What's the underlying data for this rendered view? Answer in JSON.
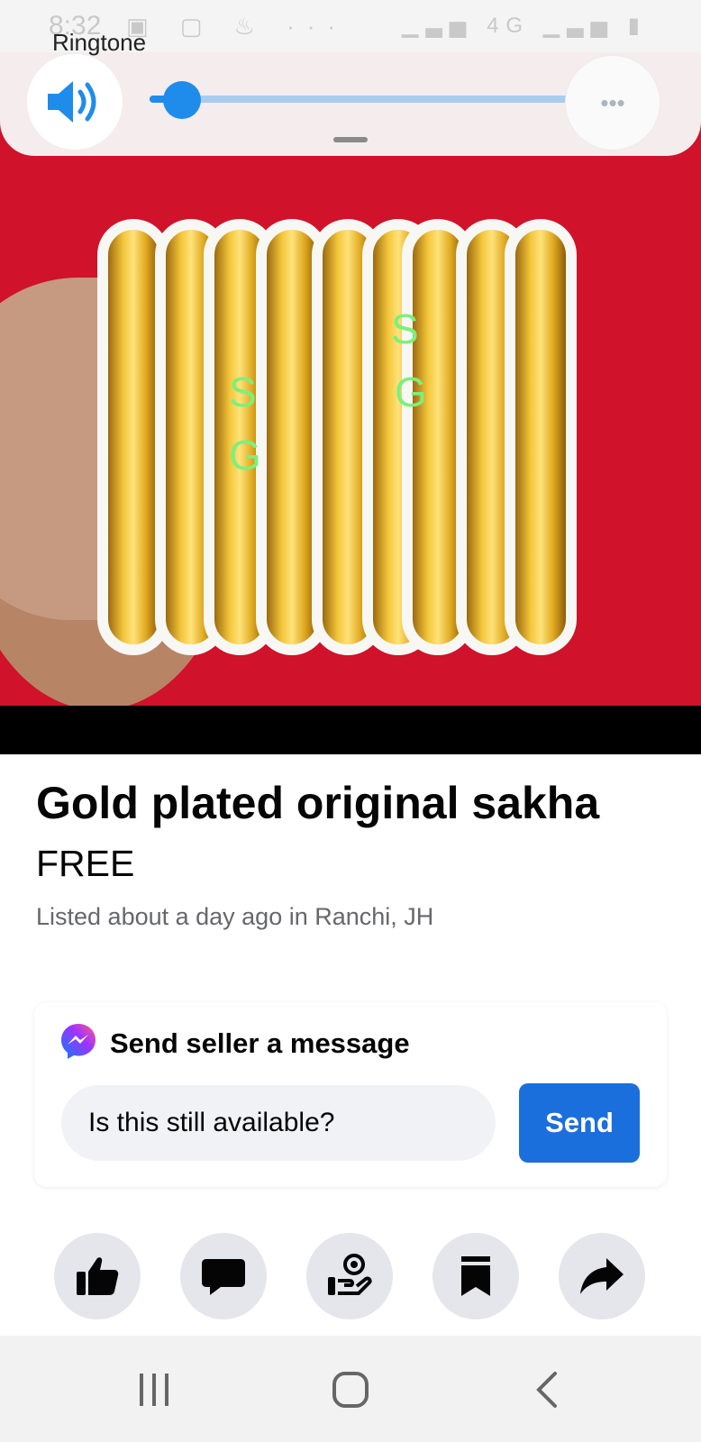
{
  "status_bar": {
    "time": "8:32",
    "network": "4G"
  },
  "volume_panel": {
    "label": "Ringtone",
    "level": 0.07,
    "accent_color": "#1f8ceb",
    "icons": [
      "volume-icon",
      "more-dots-icon"
    ]
  },
  "product_image": {
    "background_color": "#d0122a",
    "watermark": [
      "S",
      "G",
      "S",
      "G"
    ]
  },
  "listing": {
    "title": "Gold plated original sakha",
    "price": "FREE",
    "listed": "Listed about a day ago in Ranchi, JH"
  },
  "message_card": {
    "title": "Send seller a message",
    "input_value": "Is this still available?",
    "send_label": "Send",
    "send_color": "#1b6fdc"
  },
  "actions": [
    {
      "icon": "thumbs-up-icon"
    },
    {
      "icon": "chat-bubble-icon"
    },
    {
      "icon": "seller-icon"
    },
    {
      "icon": "bookmark-icon"
    },
    {
      "icon": "share-arrow-icon"
    }
  ],
  "nav_bar": {
    "icons": [
      "recent-apps-icon",
      "home-icon",
      "back-icon"
    ]
  }
}
